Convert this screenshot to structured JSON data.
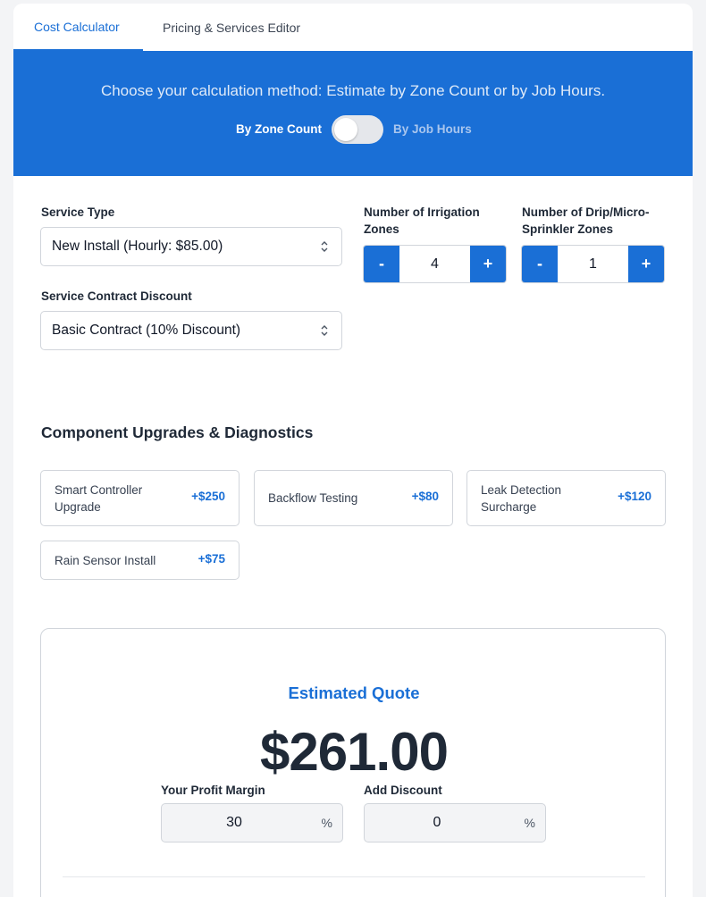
{
  "tabs": [
    {
      "label": "Cost Calculator",
      "active": true
    },
    {
      "label": "Pricing & Services Editor",
      "active": false
    }
  ],
  "banner": {
    "text": "Choose your calculation method: Estimate by Zone Count or by Job Hours.",
    "toggle_left_label": "By Zone Count",
    "toggle_right_label": "By Job Hours",
    "toggle_on": false
  },
  "form": {
    "service_type": {
      "label": "Service Type",
      "value": "New Install (Hourly: $85.00)"
    },
    "contract_discount": {
      "label": "Service Contract Discount",
      "value": "Basic Contract (10% Discount)"
    },
    "irrigation_zones": {
      "label_line1": "Number of Irrigation",
      "label_line2": "Zones",
      "value": "4"
    },
    "drip_zones": {
      "label_line1": "Number of Drip/Micro-",
      "label_line2": "Sprinkler Zones",
      "value": "1"
    },
    "minus_label": "-",
    "plus_label": "+"
  },
  "upgrades": {
    "title": "Component Upgrades & Diagnostics",
    "items": [
      {
        "line1": "Smart Controller",
        "line2": "Upgrade",
        "price": "+$250"
      },
      {
        "line1": "Backflow Testing",
        "line2": "",
        "price": "+$80"
      },
      {
        "line1": "Leak Detection",
        "line2": "Surcharge",
        "price": "+$120"
      },
      {
        "line1": "Rain Sensor Install",
        "line2": "",
        "price": "+$75"
      }
    ]
  },
  "quote": {
    "title": "Estimated Quote",
    "amount": "$261.00",
    "profit_margin": {
      "label": "Your Profit Margin",
      "value": "30",
      "unit": "%"
    },
    "add_discount": {
      "label": "Add Discount",
      "value": "0",
      "unit": "%"
    }
  },
  "colors": {
    "accent": "#1a6fd6",
    "banner_bg": "#1a6fd6",
    "text": "#1f2937",
    "border": "#d1d5db"
  }
}
